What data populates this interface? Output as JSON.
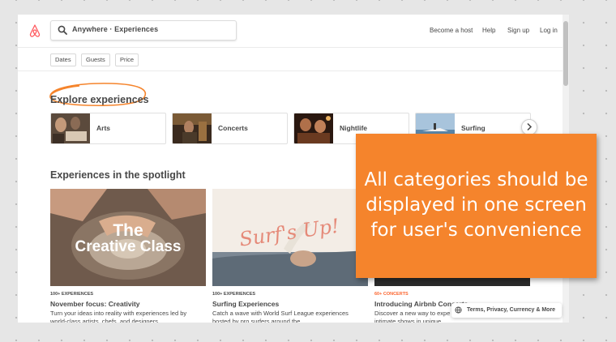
{
  "nav": {
    "search_text": "Anywhere · Experiences",
    "links": [
      "Become a host",
      "Help",
      "Sign up",
      "Log in"
    ]
  },
  "filters": [
    "Dates",
    "Guests",
    "Price"
  ],
  "explore": {
    "title": "Explore experiences",
    "categories": [
      "Arts",
      "Concerts",
      "Nightlife",
      "Surfing"
    ]
  },
  "spotlight": {
    "title": "Experiences in the spotlight",
    "cards": [
      {
        "image_text": [
          "The",
          "Creative Class"
        ],
        "kicker": "100+ EXPERIENCES",
        "title": "November focus: Creativity",
        "description": "Turn your ideas into reality with experiences led by world-class artists, chefs, and designers."
      },
      {
        "image_text": [
          "Surf's Up!"
        ],
        "kicker": "100+ EXPERIENCES",
        "title": "Surfing Experiences",
        "description": "Catch a wave with World Surf League experiences hosted by pro surfers around the"
      },
      {
        "kicker": "60+ CONCERTS",
        "title": "Introducing Airbnb Concerts",
        "description": "Discover a new way to expe intimate shows in unique spaces."
      }
    ]
  },
  "footer": {
    "label": "Terms, Privacy, Currency & More"
  },
  "annotation": {
    "lines": [
      "All categories should be",
      "displayed in one screen",
      "for user's convenience"
    ]
  },
  "colors": {
    "brand": "#ff5a5f",
    "annotation_bg": "#f5842c",
    "concerts_kicker": "#fc642d",
    "text": "#484848"
  }
}
